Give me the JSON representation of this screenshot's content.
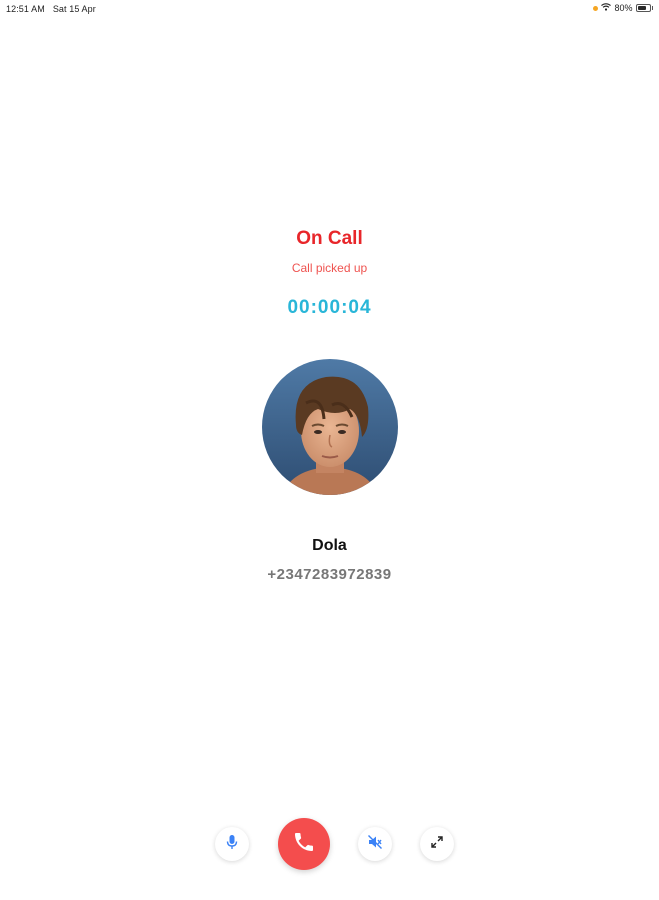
{
  "status_bar": {
    "time": "12:51 AM",
    "date": "Sat 15 Apr",
    "battery_percent": "80%",
    "battery_level": 0.8,
    "recording_dot_color": "#f5a623",
    "icons": [
      "wifi-icon",
      "battery-icon"
    ]
  },
  "call": {
    "status_title": "On Call",
    "status_subtitle": "Call picked up",
    "timer": "00:00:04",
    "title_color": "#e8262a",
    "subtitle_color": "#ef5350",
    "timer_color": "#29b6d8"
  },
  "contact": {
    "name": "Dola",
    "number": "+2347283972839",
    "avatar": "contact-photo"
  },
  "controls": {
    "mic_icon": "mic-icon",
    "end_call_icon": "phone-icon",
    "mute_speaker_icon": "speaker-mute-icon",
    "expand_icon": "expand-icon",
    "accent_blue": "#3b82f6",
    "end_call_color": "#f44d4d"
  }
}
